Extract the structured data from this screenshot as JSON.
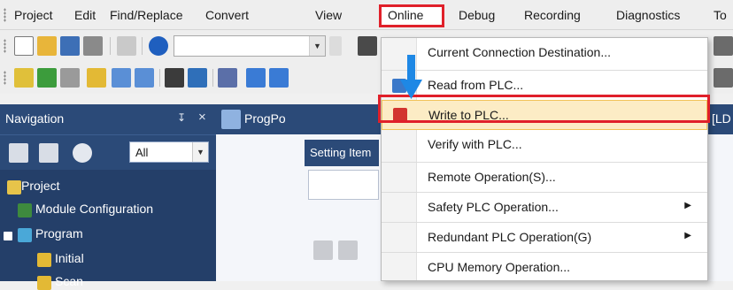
{
  "menu": {
    "items": [
      "Project",
      "Edit",
      "Find/Replace",
      "Convert",
      "View",
      "Online",
      "Debug",
      "Recording",
      "Diagnostics",
      "To"
    ],
    "active": "Online"
  },
  "navigation": {
    "title": "Navigation",
    "pin": "↧",
    "close": "×",
    "filter_value": "All",
    "tree": [
      {
        "label": "Project"
      },
      {
        "label": "Module Configuration"
      },
      {
        "label": "Program"
      },
      {
        "label": "Initial"
      },
      {
        "label": "Scan"
      }
    ]
  },
  "work_area": {
    "tab_label": "ProgPo",
    "tab_right_label": "[LD",
    "setting_label": "Setting Item"
  },
  "dropdown": {
    "items": [
      {
        "label": "Current Connection Destination...",
        "submenu": false
      },
      {
        "label": "Read from PLC...",
        "submenu": false
      },
      {
        "label": "Write to PLC...",
        "submenu": false,
        "highlighted": true
      },
      {
        "label": "Verify with PLC...",
        "submenu": false
      },
      {
        "label": "Remote Operation(S)...",
        "submenu": false
      },
      {
        "label": "Safety PLC Operation...",
        "submenu": true
      },
      {
        "label": "Redundant PLC Operation(G)",
        "submenu": true
      },
      {
        "label": "CPU Memory Operation...",
        "submenu": false
      }
    ]
  },
  "colors": {
    "highlight_frame": "#e0202a",
    "nav_background": "#2b4a78",
    "menu_highlight": "#fcecc5",
    "arrow": "#1e88e5"
  },
  "icons": {
    "submenu_arrow": "▶",
    "combo_arrow": "▼"
  }
}
